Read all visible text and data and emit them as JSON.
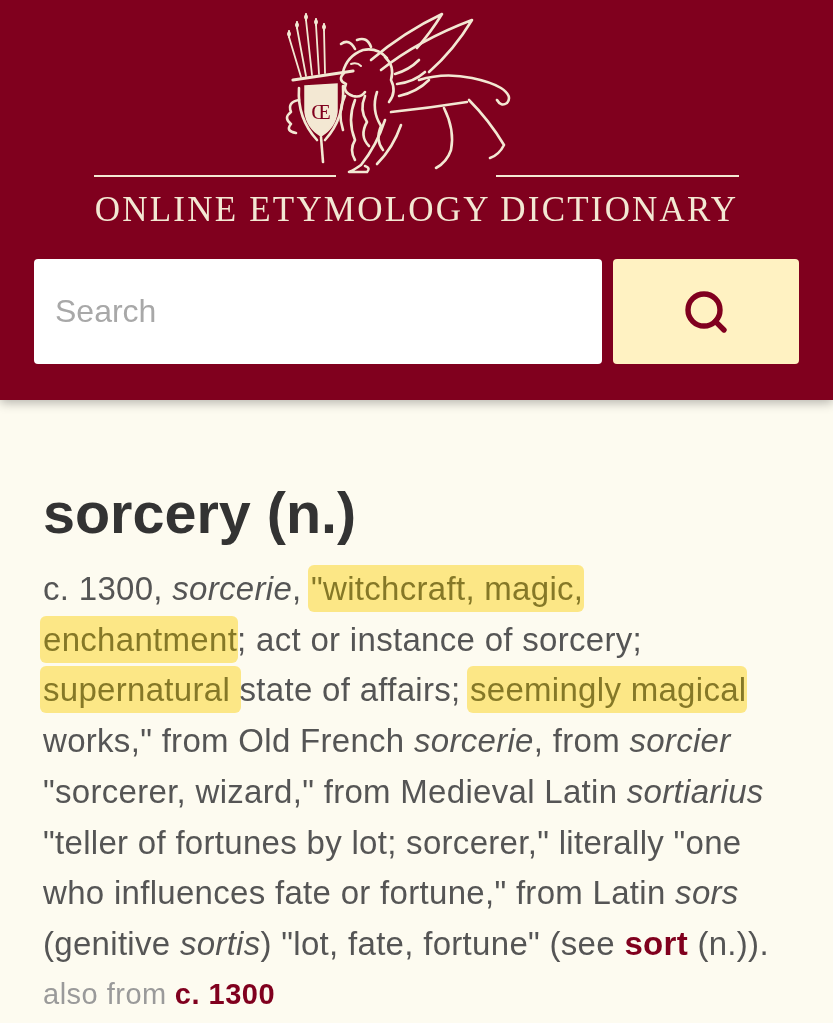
{
  "header": {
    "logo": {
      "monogram": "Œ",
      "title": "ONLINE ETYMOLOGY DICTIONARY"
    },
    "search": {
      "placeholder": "Search"
    }
  },
  "entry": {
    "headword": "sorcery (n.)",
    "segments": [
      {
        "kind": "text",
        "text": "c. 1300, *sorcerie*, ",
        "highlighted": false
      },
      {
        "kind": "text",
        "text": "\"witchcraft, magic, ",
        "highlighted": true
      },
      {
        "kind": "text",
        "text": "enchantment",
        "highlighted": true
      },
      {
        "kind": "text",
        "text": "; act or instance of sorcery; ",
        "highlighted": false
      },
      {
        "kind": "text",
        "text": "supernatural ",
        "highlighted": true
      },
      {
        "kind": "text",
        "text": "state of affairs; ",
        "highlighted": false
      },
      {
        "kind": "text",
        "text": "seemingly magical",
        "highlighted": true
      },
      {
        "kind": "text",
        "text": " works,\" from Old French *sorcerie*, from *sorcier* \"sorcerer, wizard,\" from Medieval Latin *sortiarius* \"teller of fortunes by lot; sorcerer,\" literally \"one who influences fate or fortune,\" from Latin *sors* (genitive *sortis*) \"lot, fate, fortune\" (see ",
        "highlighted": false
      },
      {
        "kind": "link",
        "text": "sort",
        "highlighted": false
      },
      {
        "kind": "text",
        "text": " (n.)).",
        "highlighted": false
      }
    ],
    "also_from": {
      "label": "also from",
      "link": "c. 1300"
    }
  }
}
